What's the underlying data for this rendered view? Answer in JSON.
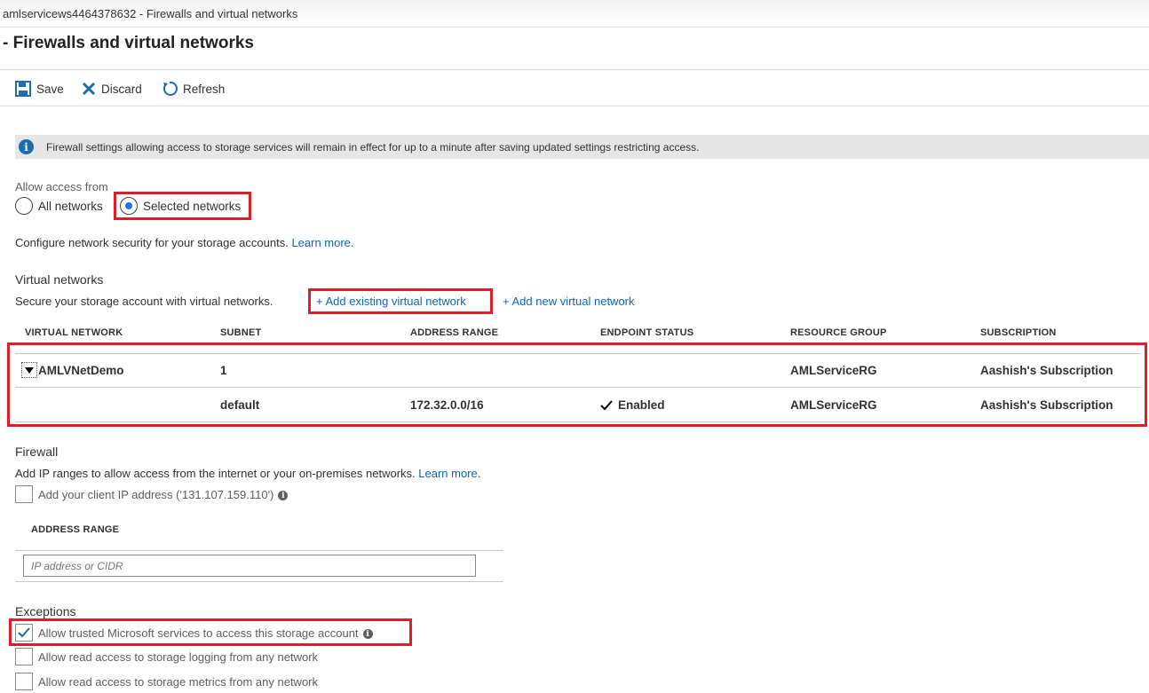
{
  "breadcrumb": "amlservicews4464378632 - Firewalls and virtual networks",
  "page_title": "- Firewalls and virtual networks",
  "toolbar": {
    "save": "Save",
    "discard": "Discard",
    "refresh": "Refresh"
  },
  "info_banner": "Firewall settings allowing access to storage services will remain in effect for up to a minute after saving updated settings restricting access.",
  "access": {
    "label": "Allow access from",
    "options": [
      "All networks",
      "Selected networks"
    ],
    "selected": "Selected networks"
  },
  "configure": {
    "text": "Configure network security for your storage accounts.",
    "link": "Learn more."
  },
  "vnets": {
    "title": "Virtual networks",
    "desc": "Secure your storage account with virtual networks.",
    "add_existing": "+ Add existing virtual network",
    "add_new": "+ Add new virtual network",
    "columns": [
      "VIRTUAL NETWORK",
      "SUBNET",
      "ADDRESS RANGE",
      "ENDPOINT STATUS",
      "RESOURCE GROUP",
      "SUBSCRIPTION"
    ],
    "rows": [
      {
        "network": "AMLVNetDemo",
        "subnet": "1",
        "address": "",
        "status": "",
        "rg": "AMLServiceRG",
        "sub": "Aashish's Subscription"
      },
      {
        "network": "",
        "subnet": "default",
        "address": "172.32.0.0/16",
        "status": "Enabled",
        "rg": "AMLServiceRG",
        "sub": "Aashish's Subscription"
      }
    ]
  },
  "firewall": {
    "title": "Firewall",
    "desc": "Add IP ranges to allow access from the internet or your on-premises networks.",
    "link": "Learn more.",
    "client_ip": "Add your client IP address ('131.107.159.110')",
    "column": "ADDRESS RANGE",
    "placeholder": "IP address or CIDR"
  },
  "exceptions": {
    "title": "Exceptions",
    "items": [
      {
        "label": "Allow trusted Microsoft services to access this storage account",
        "checked": true
      },
      {
        "label": "Allow read access to storage logging from any network",
        "checked": false
      },
      {
        "label": "Allow read access to storage metrics from any network",
        "checked": false
      }
    ]
  },
  "colors": {
    "accent": "#0a64c8",
    "highlight": "#e01e2a",
    "banner_bg": "#e6e6e6"
  }
}
